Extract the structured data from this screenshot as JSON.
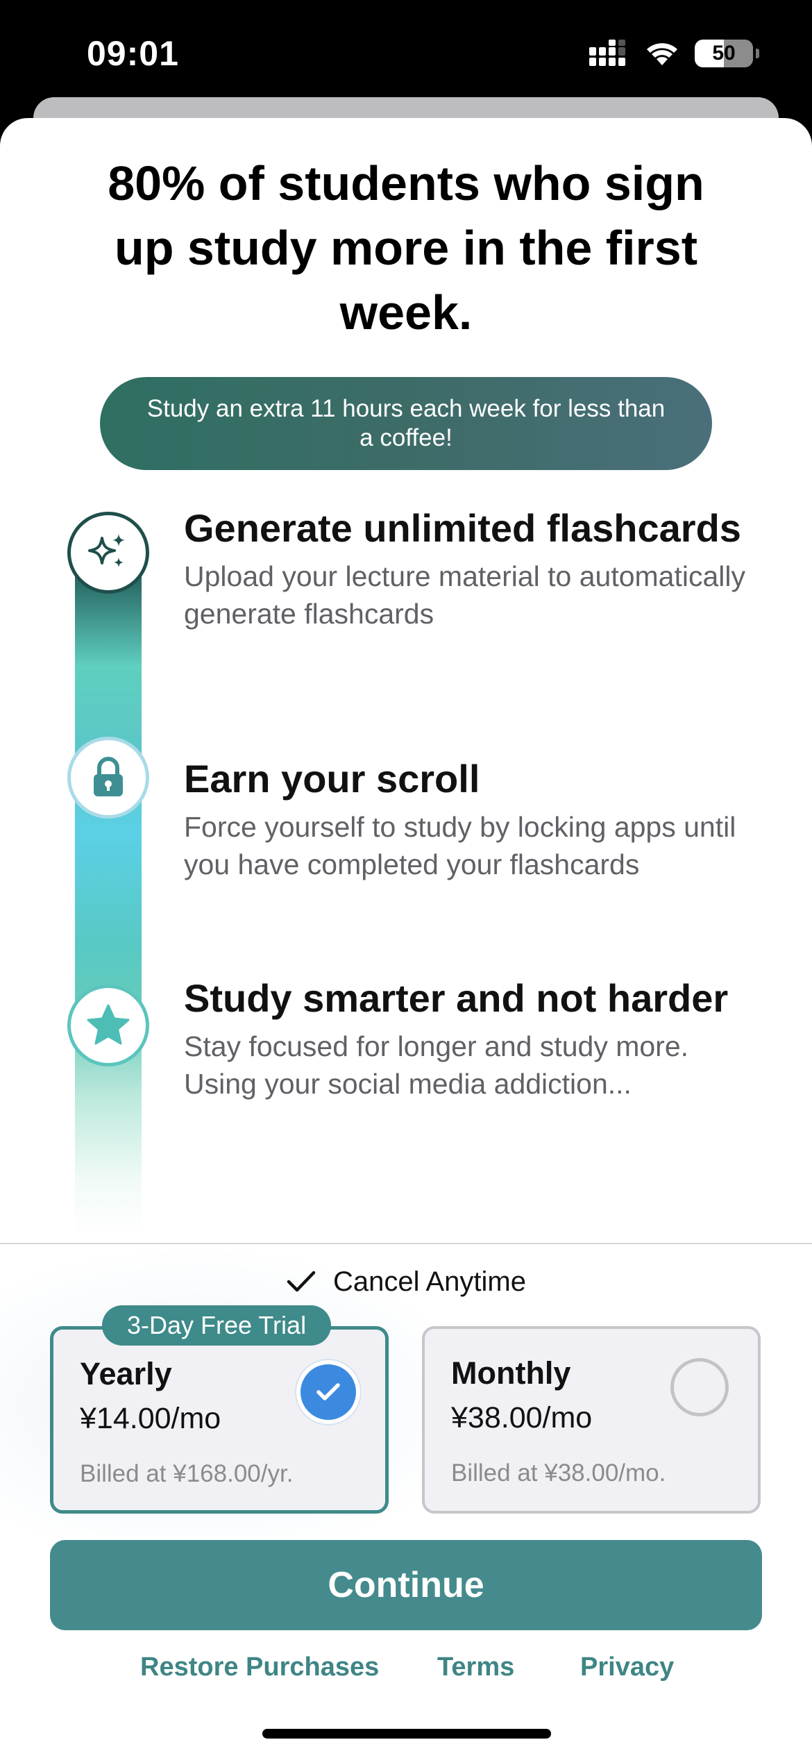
{
  "status_bar": {
    "time": "09:01",
    "battery": "50",
    "icons": [
      "cellular-signal-icon",
      "wifi-icon",
      "battery-icon"
    ]
  },
  "headline": "80% of students who sign up study more in the first week.",
  "promo": "Study an extra 11 hours each week for less than a coffee!",
  "features": [
    {
      "icon": "sparkles-icon",
      "title": "Generate unlimited flashcards",
      "description": "Upload your lecture material to automatically generate flashcards"
    },
    {
      "icon": "lock-icon",
      "title": "Earn your scroll",
      "description": "Force yourself to study by locking apps until you have completed your flashcards"
    },
    {
      "icon": "star-icon",
      "title": "Study smarter and not harder",
      "description": "Stay focused for longer and study more. Using your social media addiction..."
    }
  ],
  "cancel_anytime": "Cancel Anytime",
  "plans": {
    "yearly": {
      "badge": "3-Day Free Trial",
      "name": "Yearly",
      "price": "¥14.00/mo",
      "billed": "Billed at ¥168.00/yr.",
      "selected": true
    },
    "monthly": {
      "name": "Monthly",
      "price": "¥38.00/mo",
      "billed": "Billed at ¥38.00/mo.",
      "selected": false
    }
  },
  "continue_label": "Continue",
  "footer": {
    "restore": "Restore Purchases",
    "terms": "Terms",
    "privacy": "Privacy"
  },
  "colors": {
    "accent": "#458b8d",
    "selected_check": "#3c8ae0",
    "link": "#3f8585"
  }
}
